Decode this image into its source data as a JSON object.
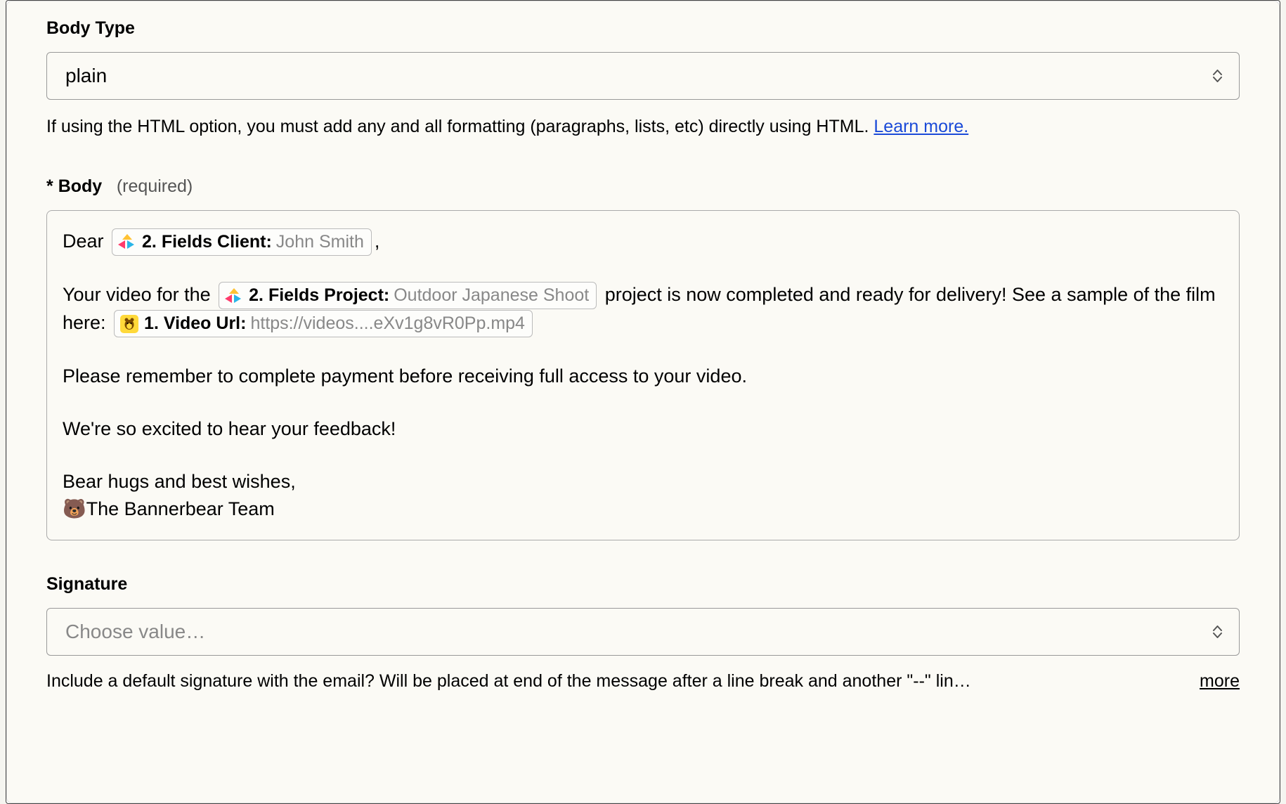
{
  "sections": {
    "bodyType": {
      "label": "Body Type",
      "value": "plain",
      "help_prefix": "If using the HTML option, you must add any and all formatting (paragraphs, lists, etc) directly using HTML. ",
      "learn_more": "Learn more."
    },
    "body": {
      "label_prefix": "* ",
      "label": "Body",
      "required_note": "(required)",
      "text": {
        "dear": "Dear ",
        "comma": ",",
        "line2_a": "Your video for the ",
        "line2_b": " project is now completed and ready for delivery! See a sample of the film here: ",
        "line3": "Please remember to complete payment before receiving full access to your video.",
        "line4": "We're so excited to hear your feedback!",
        "line5": "Bear hugs and best wishes,",
        "line6": "🐻The Bannerbear Team"
      },
      "pills": {
        "client": {
          "label": "2. Fields Client:",
          "value": "John Smith"
        },
        "project": {
          "label": "2. Fields Project:",
          "value": "Outdoor Japanese Shoot"
        },
        "video": {
          "label": "1. Video Url:",
          "value": "https://videos....eXv1g8vR0Pp.mp4"
        }
      }
    },
    "signature": {
      "label": "Signature",
      "placeholder": "Choose value…",
      "help": "Include a default signature with the email? Will be placed at end of the message after a line break and another \"--\" lin…",
      "more": "more"
    }
  }
}
